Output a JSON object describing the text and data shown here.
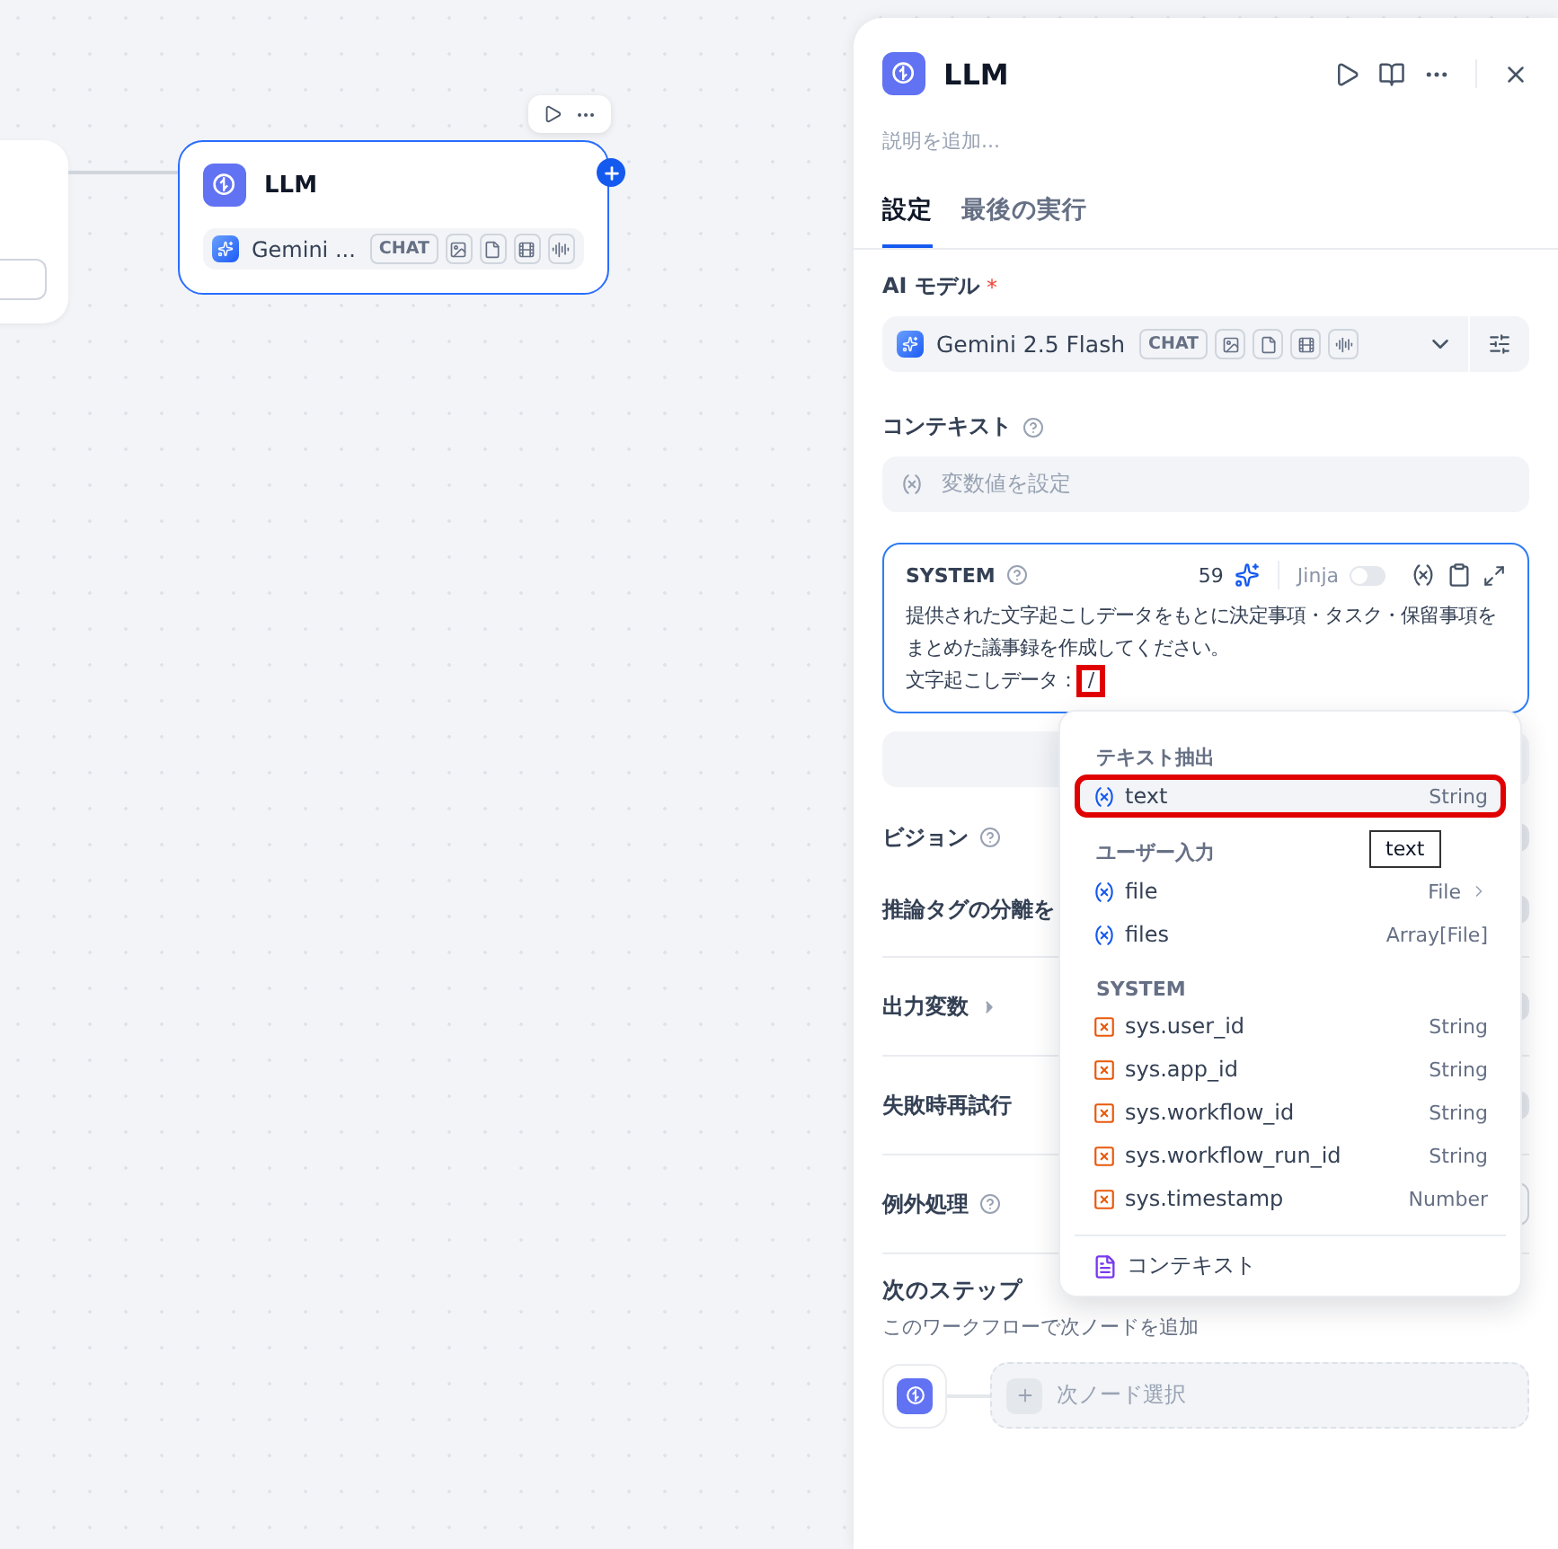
{
  "canvas": {
    "node": {
      "title": "LLM",
      "model": "Gemini ...",
      "badge": "CHAT"
    }
  },
  "panel": {
    "title": "LLM",
    "description_placeholder": "説明を追加...",
    "tabs": [
      {
        "label": "設定",
        "selected": true
      },
      {
        "label": "最後の実行",
        "selected": false
      }
    ],
    "model": {
      "label": "AI モデル",
      "required": true,
      "required_mark": "*",
      "name": "Gemini 2.5 Flash",
      "badge": "CHAT"
    },
    "context": {
      "label": "コンテキスト",
      "placeholder": "変数値を設定"
    },
    "system": {
      "label": "SYSTEM",
      "count": "59",
      "jinja_label": "Jinja",
      "jinja_on": false,
      "lines": [
        "提供された文字起こしデータをもとに決定事項・タスク・保留事項をまとめた議事録を作成してください。",
        "文字起こしデータ："
      ],
      "typed": "/"
    },
    "toggles": [
      {
        "label": "ビジョン",
        "on": false
      },
      {
        "label": "推論タグの分離を",
        "on": false
      }
    ],
    "sections": [
      {
        "label": "出力変数",
        "kind": "expand",
        "on": false
      },
      {
        "label": "失敗時再試行",
        "kind": "toggle",
        "on": false
      },
      {
        "label": "例外処理",
        "kind": "select"
      }
    ],
    "next_step": {
      "title": "次のステップ",
      "subtitle": "このワークフローで次ノードを追加",
      "select_label": "次ノード選択"
    }
  },
  "menu": {
    "groups": [
      {
        "title": "テキスト抽出",
        "items": [
          {
            "name": "text",
            "type": "String",
            "kind": "var",
            "selected": true,
            "more": false
          }
        ]
      },
      {
        "title": "ユーザー入力",
        "items": [
          {
            "name": "file",
            "type": "File",
            "kind": "var",
            "selected": false,
            "more": true
          },
          {
            "name": "files",
            "type": "Array[File]",
            "kind": "var",
            "selected": false,
            "more": false
          }
        ]
      },
      {
        "title": "SYSTEM",
        "items": [
          {
            "name": "sys.user_id",
            "type": "String",
            "kind": "sys",
            "selected": false,
            "more": false
          },
          {
            "name": "sys.app_id",
            "type": "String",
            "kind": "sys",
            "selected": false,
            "more": false
          },
          {
            "name": "sys.workflow_id",
            "type": "String",
            "kind": "sys",
            "selected": false,
            "more": false
          },
          {
            "name": "sys.workflow_run_id",
            "type": "String",
            "kind": "sys",
            "selected": false,
            "more": false
          },
          {
            "name": "sys.timestamp",
            "type": "Number",
            "kind": "sys",
            "selected": false,
            "more": false
          }
        ]
      }
    ],
    "footer": "コンテキスト",
    "tooltip": "text"
  }
}
